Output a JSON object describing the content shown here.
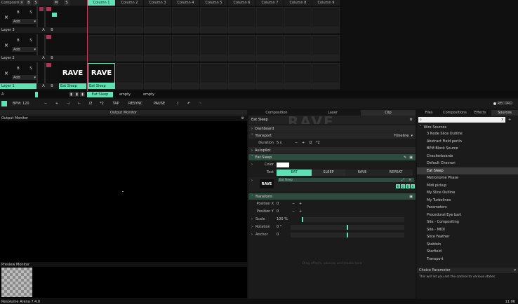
{
  "composition": {
    "label": "Composition",
    "columns": [
      "Column 1",
      "Column 2",
      "Column 3",
      "Column 4",
      "Column 5",
      "Column 6",
      "Column 7",
      "Column 8",
      "Column 9"
    ],
    "layers": [
      {
        "name": "Layer 3",
        "add": "Add"
      },
      {
        "name": "Layer 2",
        "add": "Add"
      },
      {
        "name": "Layer 1",
        "add": "Add"
      }
    ],
    "clips": [
      {
        "thumb": "RAVE",
        "label": "Eat Sleep"
      },
      {
        "thumb": "RAVE",
        "label": "Eat Sleep"
      }
    ],
    "btn_x": "×",
    "btn_b": "B",
    "btn_s": "S",
    "btn_m": "M",
    "btn_a": "A",
    "deck_a": "A",
    "deck_labels": [
      "Eat Sleep",
      "empty",
      "empty"
    ]
  },
  "transport": {
    "bpm": "BPM: 120",
    "minus": "−",
    "plus": "+",
    "div2": "/2",
    "mul2": "*2",
    "tap": "TAP",
    "resync": "RESYNC",
    "pause": "PAUSE",
    "record": "RECORD"
  },
  "output": {
    "title": "Output Monitor",
    "label": "Output Monitor",
    "preview_label": "Preview Monitor"
  },
  "center": {
    "tabs": [
      "Composition",
      "Layer",
      "Clip"
    ],
    "clip_name": "Eat Sleep",
    "watermark": "RAVE",
    "sections": {
      "dashboard": "Dashboard",
      "transport": "Transport",
      "transport_mode": "Timeline",
      "duration_label": "Duration",
      "duration_value": "5 s",
      "duration_div": "/2",
      "duration_mul": "*2",
      "autopilot": "Autopilot",
      "eat_sleep": "Eat Sleep",
      "color_label": "Color",
      "text_label": "Text",
      "text_options": [
        "EAT",
        "SLEEP",
        "RAVE",
        "REPEAT"
      ],
      "effect_title": "Eat Sleep",
      "effect_thumb": "RAVE",
      "channels": [
        "R",
        "G",
        "B",
        "A"
      ],
      "transform": "Transform",
      "pos_x": "Position X",
      "pos_y": "Position Y",
      "pos_value": "0",
      "scale": "Scale",
      "scale_value": "100 %",
      "rotation": "Rotation",
      "rotation_value": "0 °",
      "anchor": "Anchor",
      "anchor_value": "0",
      "hint": "Drag effects, sources and masks here"
    }
  },
  "right": {
    "tabs": [
      "Files",
      "Compositions",
      "Effects",
      "Sources"
    ],
    "search_placeholder": "",
    "group": "Wire Sources",
    "items": [
      "3 Node Slice Outline",
      "Abstract Field perlin",
      "BPM Block Source",
      "Checkerboards",
      "Default Chevron",
      "Eat Sleep",
      "Metronome Phase",
      "Midi pickup",
      "My Slice Outline",
      "My Turbolines",
      "Parameters",
      "Procedural Eye bart",
      "Site - Compositing",
      "Site - MIDI",
      "Slice Feather",
      "Stabloin",
      "Starfield",
      "Transport"
    ],
    "selected": "Eat Sleep",
    "info_title": "Choice Parameter",
    "info_text": "This will let you set the control to various states."
  },
  "status": {
    "app": "Resolume Arena 7.4.0",
    "time": "11:06"
  },
  "colors": {
    "accent": "#5fe0b5",
    "background": "#141414",
    "panel": "#1e1e1e"
  }
}
